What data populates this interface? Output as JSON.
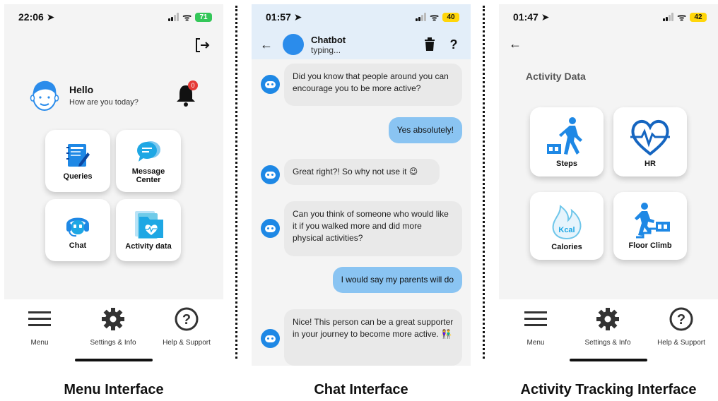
{
  "captions": {
    "menu": "Menu Interface",
    "chat": "Chat Interface",
    "activity": "Activity Tracking Interface"
  },
  "menu": {
    "status": {
      "time": "22:06",
      "battery": "71"
    },
    "greeting": {
      "title": "Hello",
      "subtitle": "How are you today?"
    },
    "notification_count": "0",
    "tiles": [
      {
        "label": "Queries",
        "icon": "notebook-icon"
      },
      {
        "label": "Message Center",
        "icon": "chat-bubbles-icon"
      },
      {
        "label": "Chat",
        "icon": "robot-headset-icon"
      },
      {
        "label": "Activity data",
        "icon": "heart-folder-icon"
      }
    ],
    "nav": [
      {
        "label": "Menu",
        "icon": "hamburger-icon"
      },
      {
        "label": "Settings & Info",
        "icon": "gear-icon"
      },
      {
        "label": "Help & Support",
        "icon": "question-icon"
      }
    ]
  },
  "chat": {
    "status": {
      "time": "01:57",
      "battery": "40"
    },
    "header": {
      "name": "Chatbot",
      "status": "typing...",
      "help": "?"
    },
    "messages": [
      {
        "from": "bot",
        "text": "Did you know that people around you can encourage you to be more active?"
      },
      {
        "from": "user",
        "text": "Yes absolutely!"
      },
      {
        "from": "bot",
        "text": "Great right?! So why not use it 😉"
      },
      {
        "from": "bot",
        "text": "Can you think of someone who would like it if you walked more and did more physical activities?"
      },
      {
        "from": "user",
        "text": "I would say my parents will do"
      },
      {
        "from": "bot",
        "text": "Nice! This person can be a great supporter in your journey to become more active. 👫"
      }
    ]
  },
  "activity": {
    "status": {
      "time": "01:47",
      "battery": "42"
    },
    "title": "Activity Data",
    "tiles": [
      {
        "label": "Steps",
        "icon": "walking-person-icon"
      },
      {
        "label": "HR",
        "icon": "heartbeat-icon"
      },
      {
        "label": "Calories",
        "icon": "flame-kcal-icon",
        "icon_text": "Kcal"
      },
      {
        "label": "Floor Climb",
        "icon": "stairs-climb-icon"
      }
    ],
    "nav": [
      {
        "label": "Menu",
        "icon": "hamburger-icon"
      },
      {
        "label": "Settings & Info",
        "icon": "gear-icon"
      },
      {
        "label": "Help & Support",
        "icon": "question-icon"
      }
    ]
  },
  "colors": {
    "accent_blue": "#1e88e5",
    "user_bubble": "#8ac4f2",
    "bot_bubble": "#e9e9e9",
    "chat_header": "#e3eef9",
    "badge_red": "#e53935"
  }
}
